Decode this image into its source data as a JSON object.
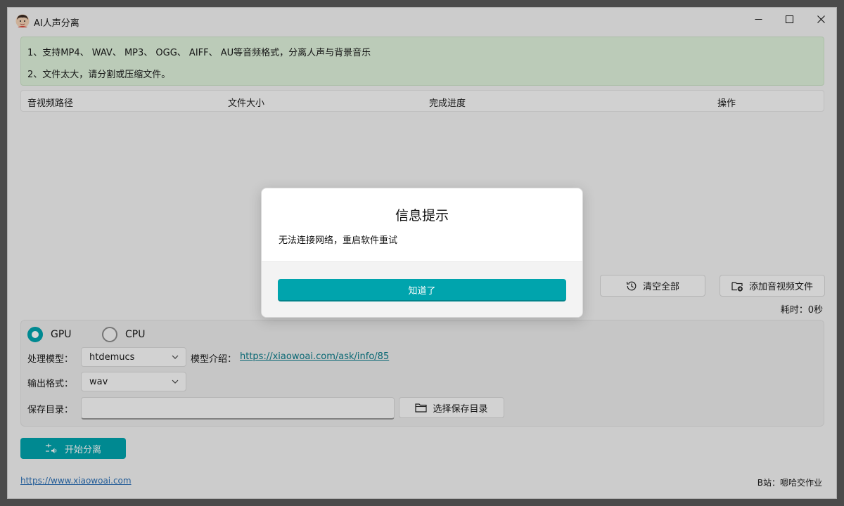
{
  "window": {
    "title": "AI人声分离"
  },
  "notice": {
    "line1": "1、支持MP4、 WAV、 MP3、 OGG、 AIFF、 AU等音频格式，分离人声与背景音乐",
    "line2": "2、文件太大，请分割或压缩文件。"
  },
  "table": {
    "columns": [
      "音视频路径",
      "文件大小",
      "完成进度",
      "操作"
    ],
    "rows": []
  },
  "actions": {
    "clear_all": "清空全部",
    "add_files": "添加音视频文件"
  },
  "elapsed": "耗时：0秒",
  "settings": {
    "device_options": [
      {
        "label": "GPU",
        "selected": true
      },
      {
        "label": "CPU",
        "selected": false
      }
    ],
    "model_label": "处理模型：",
    "model_value": "htdemucs",
    "model_intro_label": "模型介绍：",
    "model_intro_link": "https://xiaowoai.com/ask/info/85",
    "format_label": "输出格式：",
    "format_value": "wav",
    "save_dir_label": "保存目录：",
    "save_dir_value": "",
    "choose_dir_button": "选择保存目录"
  },
  "start_button": "开始分离",
  "footer": {
    "link": "https://www.xiaowoai.com",
    "right": "B站：嗯哈交作业"
  },
  "dialog": {
    "title": "信息提示",
    "message": "无法连接网络，重启软件重试",
    "ok_button": "知道了"
  },
  "colors": {
    "accent": "#00a4ad",
    "notice_bg": "#dff2dc",
    "link": "#0a7b8a"
  }
}
